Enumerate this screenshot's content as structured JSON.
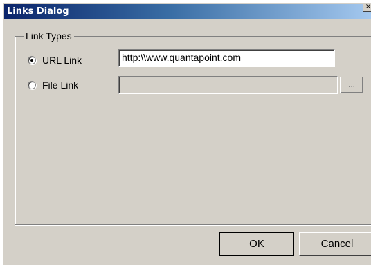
{
  "window": {
    "title": "Links Dialog",
    "close_label": "×"
  },
  "link_types": {
    "group_label": "Link Types",
    "url_link": {
      "label": "URL Link",
      "selected": true,
      "value": "http:\\\\www.quantapoint.com"
    },
    "file_link": {
      "label": "File Link",
      "selected": false,
      "value": "",
      "browse_label": "..."
    }
  },
  "buttons": {
    "ok_label": "OK",
    "cancel_label": "Cancel"
  },
  "colors": {
    "dialog_face": "#d4d0c8",
    "titlebar_start": "#0a246a",
    "titlebar_end": "#a6caf0"
  }
}
